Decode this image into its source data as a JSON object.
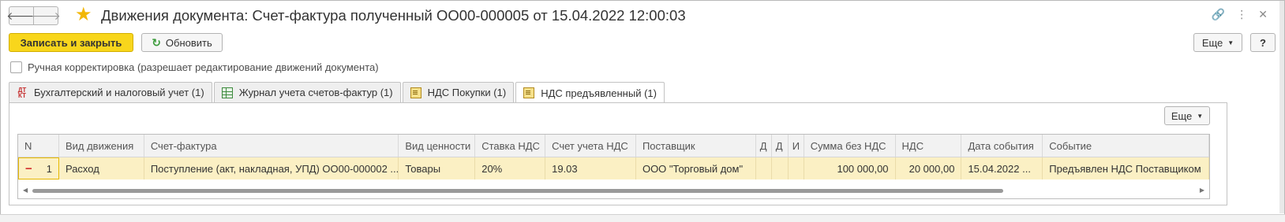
{
  "window": {
    "title": "Движения документа: Счет-фактура полученный ОО00-000005 от 15.04.2022 12:00:03",
    "back_icon": "arrow-left-icon",
    "forward_icon": "arrow-right-icon",
    "favorite_icon": "star-icon",
    "link_icon": "link-icon",
    "menu_icon": "more-vertical-icon",
    "close_icon": "close-icon"
  },
  "toolbar": {
    "save_close_label": "Записать и закрыть",
    "refresh_label": "Обновить",
    "more_label": "Еще",
    "help_label": "?"
  },
  "manual_correction": {
    "label": "Ручная корректировка (разрешает редактирование движений документа)",
    "checked": false
  },
  "tabs": [
    {
      "label": "Бухгалтерский и налоговый учет (1)",
      "icon": "dt-kt-icon",
      "icon_text_top": "ДТ",
      "icon_text_bottom": "КТ"
    },
    {
      "label": "Журнал учета счетов-фактур (1)",
      "icon": "grid-icon"
    },
    {
      "label": "НДС Покупки (1)",
      "icon": "register-icon"
    },
    {
      "label": "НДС предъявленный (1)",
      "icon": "register-icon",
      "active": true
    }
  ],
  "panel": {
    "more_label": "Еще"
  },
  "table": {
    "columns": [
      "N",
      "Вид движения",
      "Счет-фактура",
      "Вид ценности",
      "Ставка НДС",
      "Счет учета НДС",
      "Поставщик",
      "Д",
      "Д",
      "И",
      "Сумма без НДС",
      "НДС",
      "Дата события",
      "Событие"
    ],
    "rows": [
      {
        "n": "1",
        "movement_type": "Расход",
        "invoice": "Поступление (акт, накладная, УПД) ОО00-000002 ...",
        "value_type": "Товары",
        "vat_rate": "20%",
        "vat_account": "19.03",
        "supplier": "ООО \"Торговый дом\"",
        "d1": "",
        "d2": "",
        "i": "",
        "amount_without_vat": "100 000,00",
        "vat": "20 000,00",
        "event_date": "15.04.2022 ...",
        "event": "Предъявлен НДС Поставщиком"
      }
    ]
  },
  "colors": {
    "primary_button": "#f8d61c",
    "selected_row": "#fbf0c4",
    "active_tab_underline": "#d9211e",
    "star": "#f2b705"
  }
}
